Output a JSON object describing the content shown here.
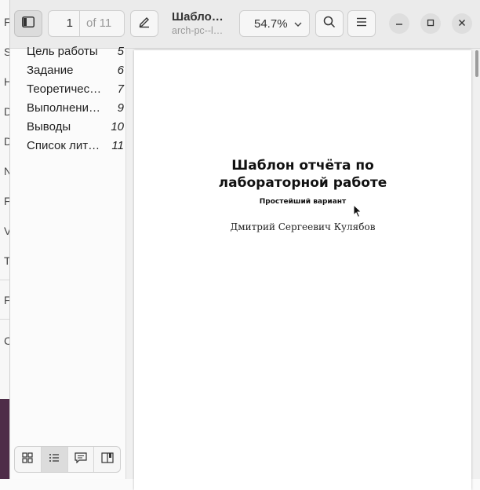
{
  "desktop": {
    "edge_letters": [
      "F",
      "S",
      "H",
      "D",
      "D",
      "N",
      "F",
      "V",
      "T",
      "F",
      "C"
    ]
  },
  "header": {
    "current_page": "1",
    "page_count_label": "of 11",
    "doc_title": "Шабло…",
    "doc_subtitle": "arch-pc--l…",
    "zoom_label": "54.7%"
  },
  "sidebar": {
    "toc": [
      {
        "label": "Цель работы",
        "page": "5"
      },
      {
        "label": "Задание",
        "page": "6"
      },
      {
        "label": "Теоретичес…",
        "page": "7"
      },
      {
        "label": "Выполнени…",
        "page": "9"
      },
      {
        "label": "Выводы",
        "page": "10"
      },
      {
        "label": "Список лит…",
        "page": "11"
      }
    ]
  },
  "document": {
    "title": "Шаблон отчёта по лабораторной работе",
    "subtitle": "Простейший вариант",
    "author": "Дмитрий Сергеевич Кулябов"
  },
  "colors": {
    "header_bg": "#ebebeb",
    "sidebar_bg": "#fbfbfb",
    "desktop_accent": "#4e2d48"
  }
}
